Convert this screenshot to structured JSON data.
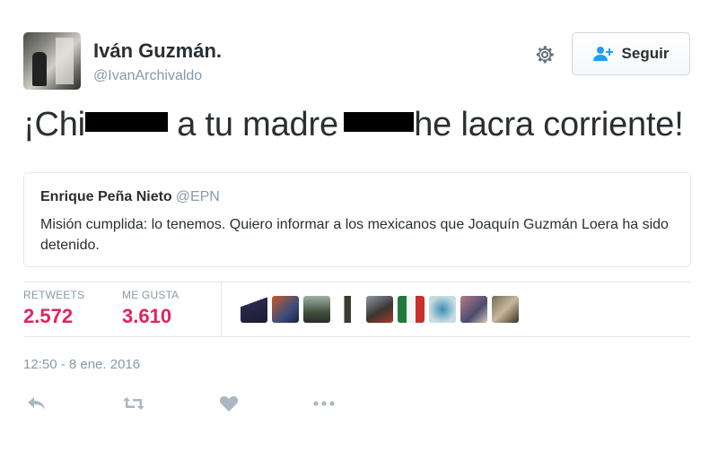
{
  "author": {
    "name": "Iván Guzmán.",
    "handle": "@IvanArchivaldo"
  },
  "follow_button": {
    "label": "Seguir",
    "icon": "add-user-icon"
  },
  "tweet": {
    "text_part1": "¡Chi",
    "text_part2": " a tu madre ",
    "text_part3": "he lacra corriente!"
  },
  "quoted_tweet": {
    "author_name": "Enrique Peña Nieto",
    "author_handle": "@EPN",
    "text": "Misión cumplida: lo tenemos. Quiero informar a los mexicanos que Joaquín Guzmán Loera ha sido detenido."
  },
  "stats": {
    "retweets_label": "RETWEETS",
    "retweets_value": "2.572",
    "likes_label": "ME GUSTA",
    "likes_value": "3.610"
  },
  "likers_count_shown": 9,
  "timestamp": "12:50 - 8 ene. 2016",
  "actions": [
    "reply-icon",
    "retweet-icon",
    "like-icon",
    "more-icon"
  ],
  "colors": {
    "stat_value": "#e0245e",
    "muted": "#8899a6",
    "text": "#292f33",
    "border": "#e1e8ed"
  }
}
